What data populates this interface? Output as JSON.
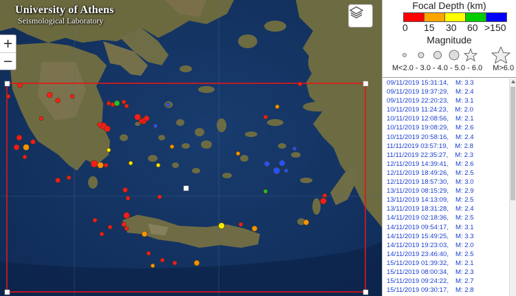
{
  "branding": {
    "university": "University of Athens",
    "laboratory": "Seismological Laboratory"
  },
  "controls": {
    "zoom_in": "+",
    "zoom_out": "−"
  },
  "legend": {
    "depth_title": "Focal Depth (km)",
    "depth_labels": [
      "0",
      "15",
      "30",
      "60",
      ">150"
    ],
    "depth_colors": [
      "#ff0000",
      "#ffa500",
      "#ffff00",
      "#00cc00",
      "#0000ff"
    ],
    "magnitude_title": "Magnitude",
    "magnitude_labels": "M<2.0 - 3.0 - 4.0 - 5.0 - 6.0",
    "magnitude_last": "M>6.0"
  },
  "events": [
    {
      "datetime": "09/11/2019 15:31:14",
      "mag": "M: 3.3"
    },
    {
      "datetime": "09/11/2019 19:37:29",
      "mag": "M: 2.4"
    },
    {
      "datetime": "09/11/2019 22:20:23",
      "mag": "M: 3.1"
    },
    {
      "datetime": "10/11/2019 11:24:23",
      "mag": "M: 2.0"
    },
    {
      "datetime": "10/11/2019 12:08:56",
      "mag": "M: 2.1"
    },
    {
      "datetime": "10/11/2019 19:08:29",
      "mag": "M: 2.6"
    },
    {
      "datetime": "10/11/2019 20:58:16",
      "mag": "M: 2.4"
    },
    {
      "datetime": "11/11/2019 03:57:19",
      "mag": "M: 2.8"
    },
    {
      "datetime": "11/11/2019 22:35:27",
      "mag": "M: 2.3"
    },
    {
      "datetime": "12/11/2019 14:39:41",
      "mag": "M: 2.6"
    },
    {
      "datetime": "12/11/2019 18:49:26",
      "mag": "M: 2.5"
    },
    {
      "datetime": "12/11/2019 18:57:30",
      "mag": "M: 3.0"
    },
    {
      "datetime": "13/11/2019 08:15:29",
      "mag": "M: 2.9"
    },
    {
      "datetime": "13/11/2019 14:13:09",
      "mag": "M: 2.5"
    },
    {
      "datetime": "13/11/2019 18:31:28",
      "mag": "M: 2.4"
    },
    {
      "datetime": "14/11/2019 02:18:36",
      "mag": "M: 2.5"
    },
    {
      "datetime": "14/11/2019 09:54:17",
      "mag": "M: 3.1"
    },
    {
      "datetime": "14/11/2019 15:49:25",
      "mag": "M: 3.3"
    },
    {
      "datetime": "14/11/2019 19:23:03",
      "mag": "M: 2.0"
    },
    {
      "datetime": "14/11/2019 23:46:40",
      "mag": "M: 2.5"
    },
    {
      "datetime": "15/11/2019 01:39:32",
      "mag": "M: 2.1"
    },
    {
      "datetime": "15/11/2019 08:00:34",
      "mag": "M: 2.3"
    },
    {
      "datetime": "15/11/2019 09:24:22",
      "mag": "M: 2.7"
    },
    {
      "datetime": "15/11/2019 09:30:17",
      "mag": "M: 2.8"
    }
  ]
}
